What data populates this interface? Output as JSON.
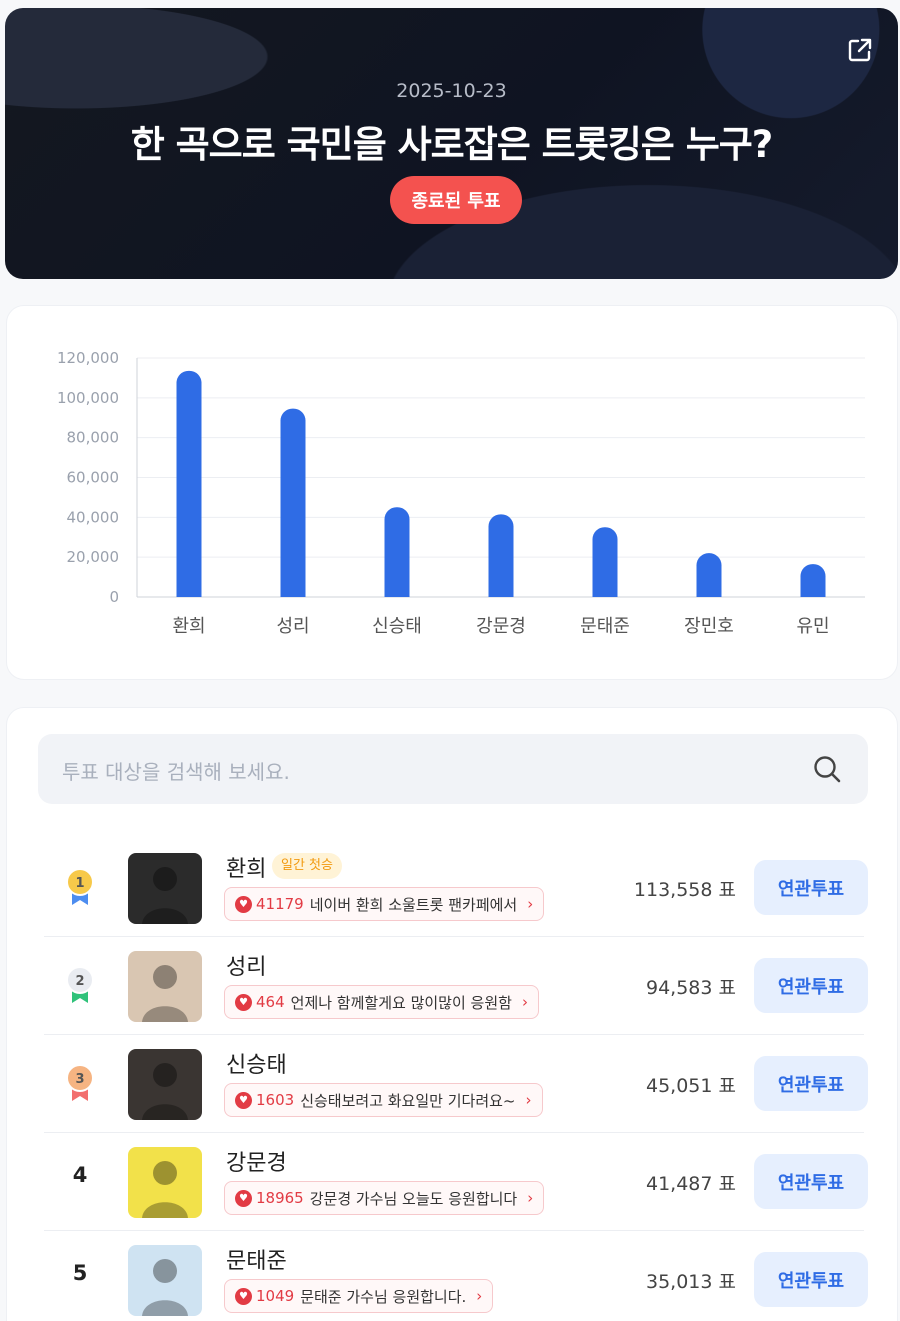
{
  "header": {
    "date": "2025-10-23",
    "title": "한 곡으로 국민을 사로잡은 트롯킹은 누구?",
    "status_badge": "종료된 투표",
    "share_icon": "share-icon"
  },
  "chart_data": {
    "type": "bar",
    "categories": [
      "환희",
      "성리",
      "신승태",
      "강문경",
      "문태준",
      "장민호",
      "유민"
    ],
    "values": [
      113558,
      94583,
      45051,
      41487,
      35013,
      22000,
      16500
    ],
    "ylim": [
      0,
      120000
    ],
    "yticks": [
      "0",
      "20,000",
      "40,000",
      "60,000",
      "80,000",
      "100,000",
      "120,000"
    ],
    "bar_color": "#2f6ce5",
    "grid": true
  },
  "search": {
    "placeholder": "투표 대상을 검색해 보세요.",
    "icon": "search-icon"
  },
  "list": [
    {
      "rank": "1",
      "medal": "gold",
      "name": "환희",
      "tag": "일간 첫승",
      "cheer_count": "41179",
      "cheer_msg": "네이버 환희 소울트롯 팬카페에서",
      "votes": "113,558 표",
      "button": "연관투표",
      "thumb_bg": "#2b2b2b"
    },
    {
      "rank": "2",
      "medal": "silver",
      "name": "성리",
      "tag": "",
      "cheer_count": "464",
      "cheer_msg": "언제나 함께할게요 많이많이 응원함",
      "votes": "94,583 표",
      "button": "연관투표",
      "thumb_bg": "#d9c6b2"
    },
    {
      "rank": "3",
      "medal": "bronze",
      "name": "신승태",
      "tag": "",
      "cheer_count": "1603",
      "cheer_msg": "신승태보려고 화요일만 기다려요~",
      "votes": "45,051 표",
      "button": "연관투표",
      "thumb_bg": "#3a3532"
    },
    {
      "rank": "4",
      "medal": "",
      "name": "강문경",
      "tag": "",
      "cheer_count": "18965",
      "cheer_msg": "강문경 가수님 오늘도 응원합니다",
      "votes": "41,487 표",
      "button": "연관투표",
      "thumb_bg": "#f2e14a"
    },
    {
      "rank": "5",
      "medal": "",
      "name": "문태준",
      "tag": "",
      "cheer_count": "1049",
      "cheer_msg": "문태준 가수님 응원합니다.",
      "votes": "35,013 표",
      "button": "연관투표",
      "thumb_bg": "#cfe3f2"
    }
  ]
}
